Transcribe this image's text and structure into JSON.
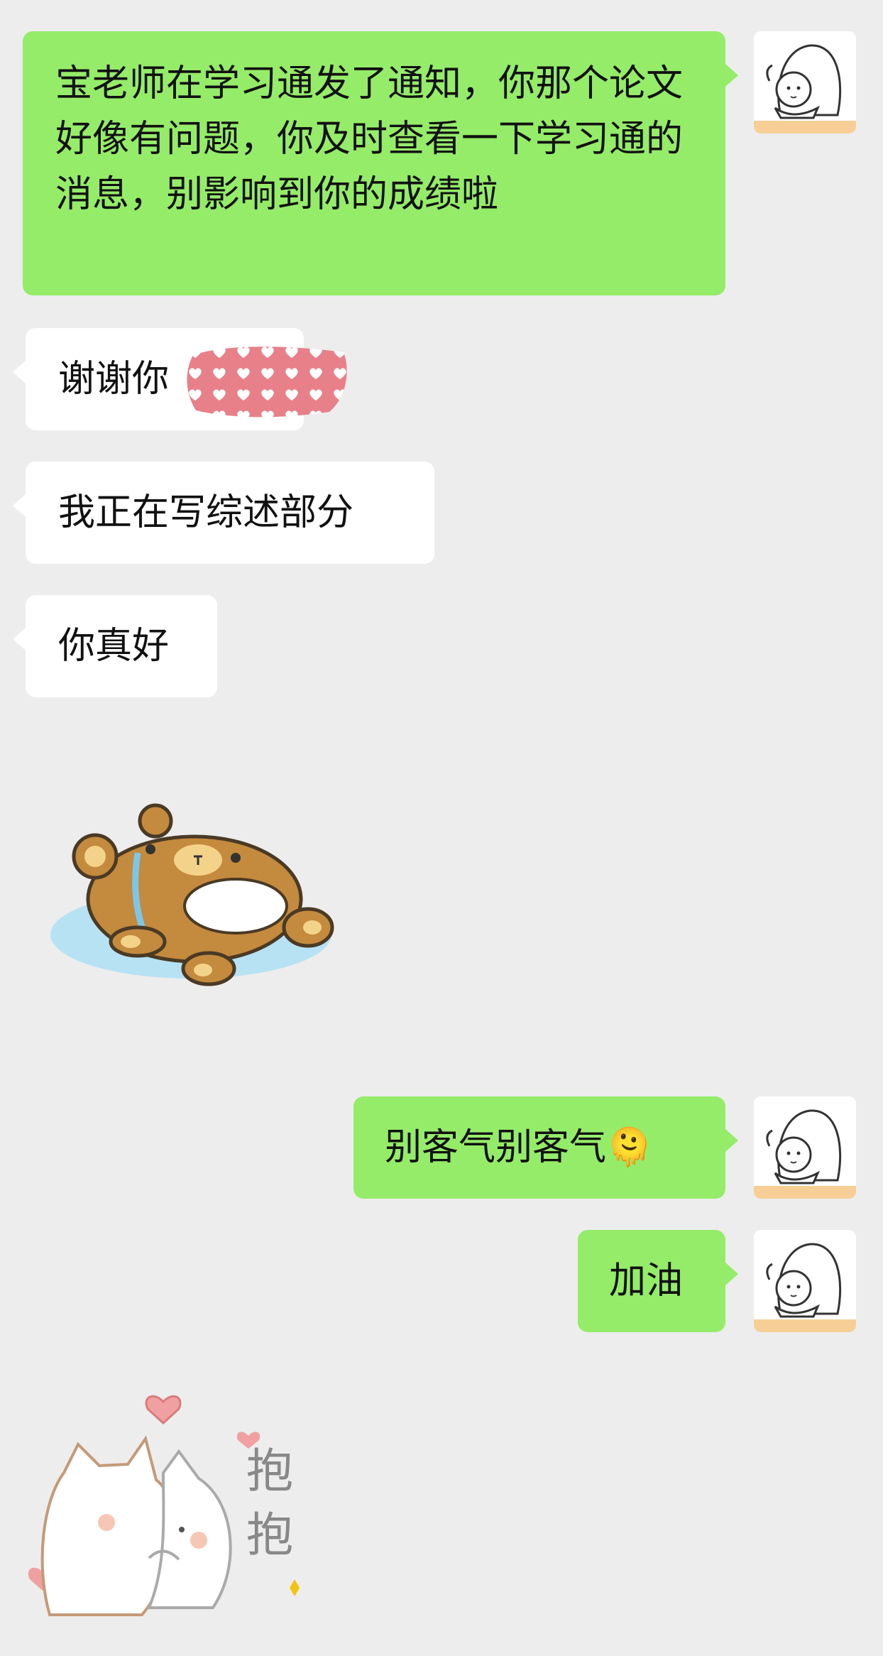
{
  "messages": [
    {
      "direction": "outgoing",
      "type": "text",
      "text": "宝老师在学习通发了通知，你那个论文好像有问题，你及时查看一下学习通的消息，别影响到你的成绩啦"
    },
    {
      "direction": "incoming",
      "type": "text",
      "text": "谢谢你"
    },
    {
      "direction": "incoming",
      "type": "text",
      "text": "我正在写综述部分"
    },
    {
      "direction": "incoming",
      "type": "text",
      "text": "你真好"
    },
    {
      "direction": "incoming",
      "type": "sticker",
      "sticker": "crying-bear-sticker"
    },
    {
      "direction": "outgoing",
      "type": "text",
      "text": "别客气别客气",
      "emoji": "🫠"
    },
    {
      "direction": "outgoing",
      "type": "text",
      "text": "加油"
    },
    {
      "direction": "incoming",
      "type": "sticker",
      "sticker": "hug-cats-sticker",
      "sticker_text": "抱抱"
    }
  ],
  "colors": {
    "background": "#ededed",
    "outgoing_bubble": "#95ec69",
    "incoming_bubble": "#ffffff",
    "text": "#111111"
  },
  "avatar_icon": "cartoon-girl-avatar"
}
